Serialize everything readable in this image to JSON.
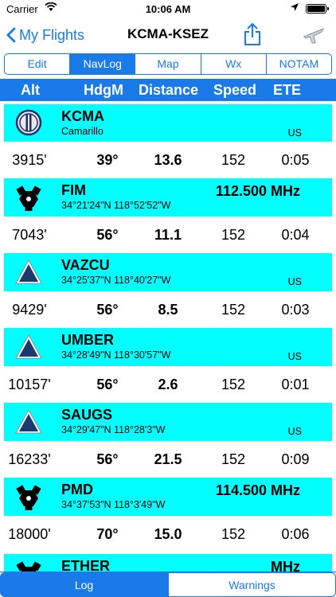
{
  "status_bar": {
    "carrier": "Carrier",
    "time": "10:06 AM"
  },
  "nav": {
    "back_label": "My Flights",
    "title": "KCMA-KSEZ"
  },
  "segments": [
    {
      "label": "Edit",
      "active": false
    },
    {
      "label": "NavLog",
      "active": true
    },
    {
      "label": "Map",
      "active": false
    },
    {
      "label": "Wx",
      "active": false
    },
    {
      "label": "NOTAM",
      "active": false
    }
  ],
  "columns": {
    "alt": "Alt",
    "hdg": "HdgM",
    "dist": "Distance",
    "speed": "Speed",
    "ete": "ETE"
  },
  "waypoints": [
    {
      "ident": "KCMA",
      "sub": "Camarillo",
      "country": "US",
      "freq": "",
      "type": "airport"
    },
    {
      "ident": "FIM",
      "sub": "34°21'24\"N  118°52'52\"W",
      "country": "",
      "freq": "112.500 MHz",
      "type": "vor"
    },
    {
      "ident": "VAZCU",
      "sub": "34°25'37\"N  118°40'27\"W",
      "country": "US",
      "freq": "",
      "type": "fix"
    },
    {
      "ident": "UMBER",
      "sub": "34°28'49\"N  118°30'57\"W",
      "country": "US",
      "freq": "",
      "type": "fix"
    },
    {
      "ident": "SAUGS",
      "sub": "34°29'47\"N  118°28'3\"W",
      "country": "US",
      "freq": "",
      "type": "fix"
    },
    {
      "ident": "PMD",
      "sub": "34°37'53\"N  118°3'49\"W",
      "country": "",
      "freq": "114.500 MHz",
      "type": "vor"
    },
    {
      "ident": "ETHER",
      "sub": "",
      "country": "",
      "freq": "MHz",
      "type": "vor"
    }
  ],
  "legs": [
    {
      "alt": "3915'",
      "hdg": "39°",
      "dist": "13.6",
      "speed": "152",
      "ete": "0:05"
    },
    {
      "alt": "7043'",
      "hdg": "56°",
      "dist": "11.1",
      "speed": "152",
      "ete": "0:04"
    },
    {
      "alt": "9429'",
      "hdg": "56°",
      "dist": "8.5",
      "speed": "152",
      "ete": "0:03"
    },
    {
      "alt": "10157'",
      "hdg": "56°",
      "dist": "2.6",
      "speed": "152",
      "ete": "0:01"
    },
    {
      "alt": "16233'",
      "hdg": "56°",
      "dist": "21.5",
      "speed": "152",
      "ete": "0:09"
    },
    {
      "alt": "18000'",
      "hdg": "70°",
      "dist": "15.0",
      "speed": "152",
      "ete": "0:06"
    }
  ],
  "tabs": [
    {
      "label": "Log",
      "active": true
    },
    {
      "label": "Warnings",
      "active": false
    }
  ],
  "colors": {
    "accent": "#1a7be8",
    "waypoint_bg": "#00ffff"
  }
}
